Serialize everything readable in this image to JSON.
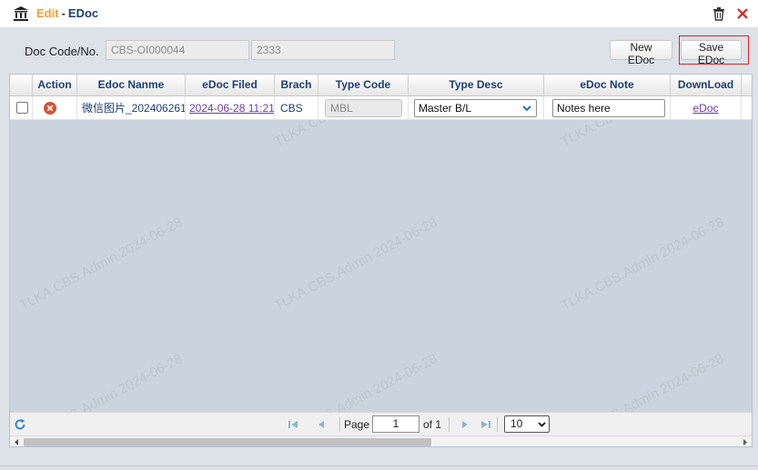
{
  "title": {
    "edit": "Edit",
    "sep": "-",
    "doc": "EDoc"
  },
  "form": {
    "label": "Doc Code/No.",
    "doc_code_value": "CBS-OI000044",
    "doc_no_value": "2333",
    "new_button": "New EDoc",
    "save_button": "Save EDoc"
  },
  "grid": {
    "columns": [
      "Action",
      "Edoc Nanme",
      "eDoc Filed",
      "Brach",
      "Type Code",
      "Type Desc",
      "eDoc Note",
      "DownLoad"
    ],
    "rows": [
      {
        "name": "微信图片_202406261",
        "filed": "2024-06-28 11:21",
        "brach": "CBS",
        "type_code": "MBL",
        "type_desc": "Master B/L",
        "note": "Notes here",
        "download": "eDoc"
      }
    ]
  },
  "pager": {
    "page_label": "Page",
    "page_value": "1",
    "of_label": "of 1",
    "page_size": "10"
  },
  "watermark": "TLKA.CBS.Admin 2024-06-28",
  "colors": {
    "accent": "#f0a030",
    "header_text": "#1c3f74",
    "link": "#6a3aa8",
    "delete": "#e05030",
    "close": "#e02020"
  },
  "icons": [
    "bank-icon",
    "trash-icon",
    "close-icon",
    "delete-icon",
    "chevron-down-icon",
    "refresh-icon",
    "first-page-icon",
    "prev-page-icon",
    "next-page-icon",
    "last-page-icon"
  ]
}
